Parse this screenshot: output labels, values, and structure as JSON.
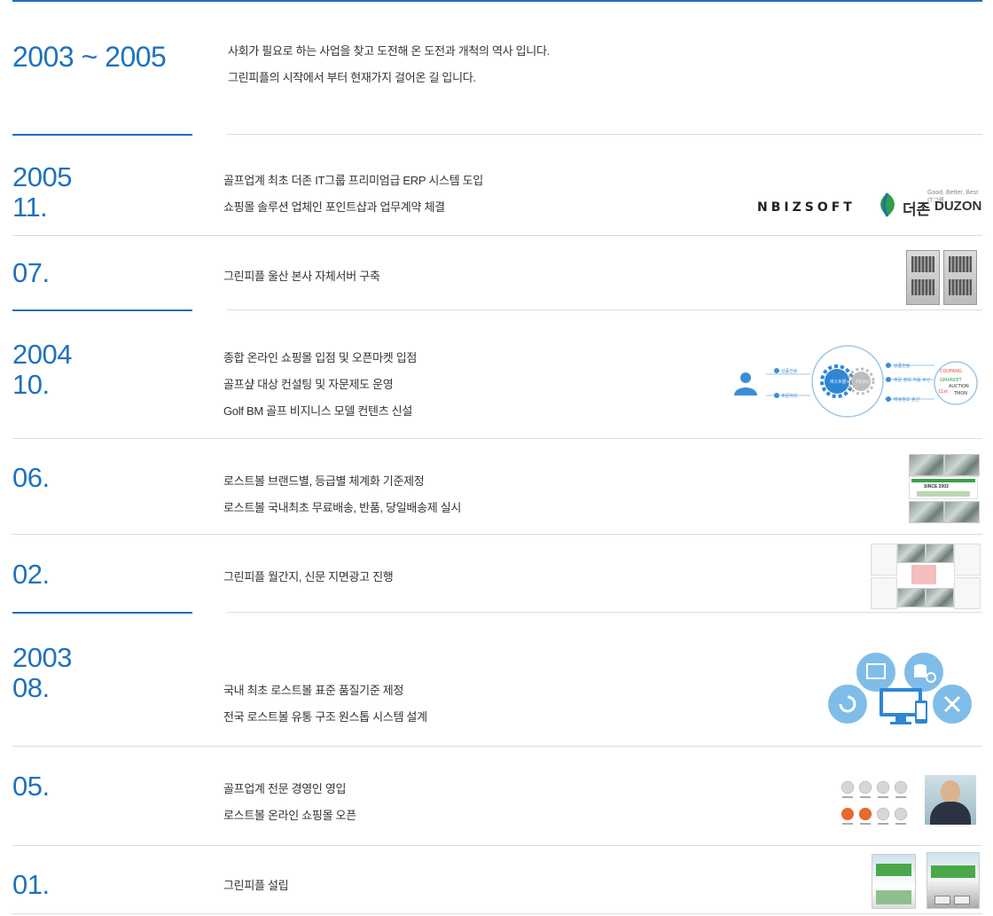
{
  "intro": {
    "period": "2003 ~ 2005",
    "lines": [
      "사회가 필요로 하는 사업을 찾고 도전해 온 도전과 개척의 역사 입니다.",
      "그린피플의 시작에서 부터 현재가지 걸어온 길 입니다."
    ]
  },
  "timeline": [
    {
      "year": "2005",
      "month": "11.",
      "lines": [
        "골프업계 최초 더존 IT그룹 프리미엄급 ERP 시스템 도입",
        "쇼핑몰 솔루션 업체인 포인트샵과 업무계약 체결"
      ]
    },
    {
      "month": "07.",
      "lines": [
        "그린피플 울산 본사 자체서버 구축"
      ]
    },
    {
      "year": "2004",
      "month": "10.",
      "lines": [
        "종합 온라인 쇼핑몰 입점 및 오픈마켓 입점",
        "골프샾 대상 컨설팅 및 자문제도 운영",
        "Golf BM 골프 비지니스 모델 컨텐츠 신설"
      ]
    },
    {
      "month": "06.",
      "lines": [
        "로스트볼 브랜드별, 등급별 체계화 기준제정",
        "로스트볼 국내최초 무료배송, 반품, 당일배송제 실시"
      ]
    },
    {
      "month": "02.",
      "lines": [
        "그린피플 월간지, 신문 지면광고 진행"
      ]
    },
    {
      "year": "2003",
      "month": "08.",
      "lines": [
        "국내 최초 로스트볼 표준 품질기준 제정",
        "전국 로스트볼 유통 구조 원스톱 시스템 설계"
      ]
    },
    {
      "month": "05.",
      "lines": [
        "골프업계 전문 경영인 영입",
        "로스트볼 온라인 쇼핑몰 오픈"
      ]
    },
    {
      "month": "01.",
      "lines": [
        "그린피플 설립"
      ]
    }
  ],
  "logos": {
    "nbizsoft": "NBIZSOFT",
    "duzon_kr": "더존",
    "duzon_en": "DUZON",
    "duzon_tag": "Good, Better, Best IT그룹"
  },
  "diagram": {
    "hub": "퍼스트몰",
    "hub2": "주문관리",
    "left_top": "상품전송",
    "left_bottom": "주문처리",
    "right_top": "상품전송",
    "right_mid": "주문 정보 자동 수신",
    "right_bottom": "배송정보 송신",
    "markets": [
      "COUPANG",
      "GMARKET",
      "AUCTION",
      "11st",
      "TMON"
    ]
  },
  "photo_caption": "SINCE 2003",
  "colors": {
    "accent": "#1f72bd",
    "line": "#dcdcdc",
    "icon_blue": "#7fbde9"
  }
}
